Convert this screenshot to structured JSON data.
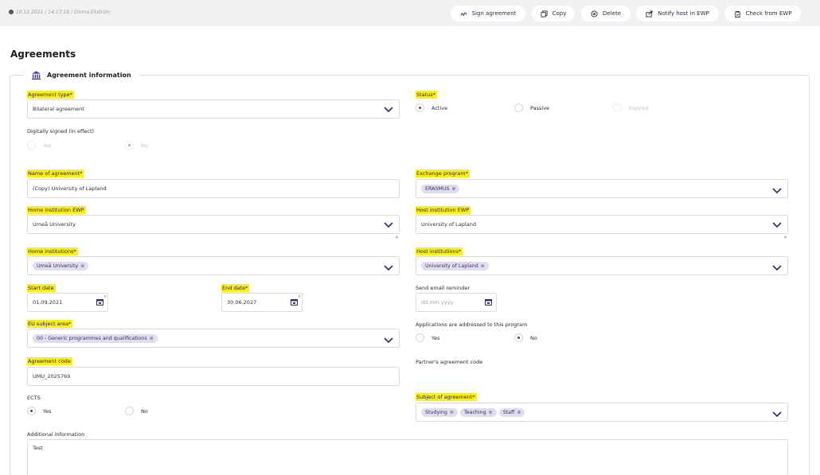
{
  "meta": "10.12.2021 / 14:17:18 / Emma Ekström",
  "toolbar": {
    "sign": "Sign agreement",
    "copy": "Copy",
    "delete": "Delete",
    "notify": "Notify host in EWP",
    "check": "Check from EWP"
  },
  "page_title": "Agreements",
  "section_title": "Agreement information",
  "colors": {
    "highlight": "#fbee1e",
    "accent": "#4a3d8f",
    "chip": "#e2dcef"
  },
  "fields": {
    "agreement_type": {
      "label": "Agreement type*",
      "value": "Bilateral agreement"
    },
    "status": {
      "label": "Status*",
      "options": [
        "Active",
        "Passive",
        "Expired"
      ],
      "selected": "Active"
    },
    "digitally_signed": {
      "label": "Digitally signed (in effect)",
      "options": [
        "Yes",
        "No"
      ],
      "selected": "No"
    },
    "name": {
      "label": "Name of agreement*",
      "value": "(Copy) University of Lapland"
    },
    "exchange_program": {
      "label": "Exchange program*",
      "chips": [
        "ERASMUS"
      ]
    },
    "home_ewp": {
      "label": "Home institution EWP",
      "value": "Umeå University"
    },
    "host_ewp": {
      "label": "Host institution EWP",
      "value": "University of Lapland"
    },
    "home_institutions": {
      "label": "Home institutions*",
      "chips": [
        "Umeå University"
      ]
    },
    "host_institutions": {
      "label": "Host institutions*",
      "chips": [
        "University of Lapland"
      ]
    },
    "start_date": {
      "label": "Start date",
      "value": "01.09.2021"
    },
    "end_date": {
      "label": "End date*",
      "value": "30.06.2027"
    },
    "email_reminder": {
      "label": "Send email reminder",
      "placeholder": "dd.mm.yyyy"
    },
    "eu_subject": {
      "label": "EU subject area*",
      "chips": [
        "00 - Generic programmes and qualifications"
      ]
    },
    "applications": {
      "label": "Applications are addressed to this program",
      "options": [
        "Yes",
        "No"
      ],
      "selected": "No"
    },
    "agreement_code": {
      "label": "Agreement code",
      "value": "UMU_2025769"
    },
    "partner_code": {
      "label": "Partner's agreement code"
    },
    "ects": {
      "label": "ECTS",
      "options": [
        "Yes",
        "No"
      ],
      "selected": "Yes"
    },
    "subject_of_agreement": {
      "label": "Subject of agreement*",
      "chips": [
        "Studying",
        "Teaching",
        "Staff"
      ]
    },
    "additional_info": {
      "label": "Additional information",
      "value": "Test"
    }
  },
  "icons": {
    "chip_remove": "⊗",
    "clear": "×"
  }
}
